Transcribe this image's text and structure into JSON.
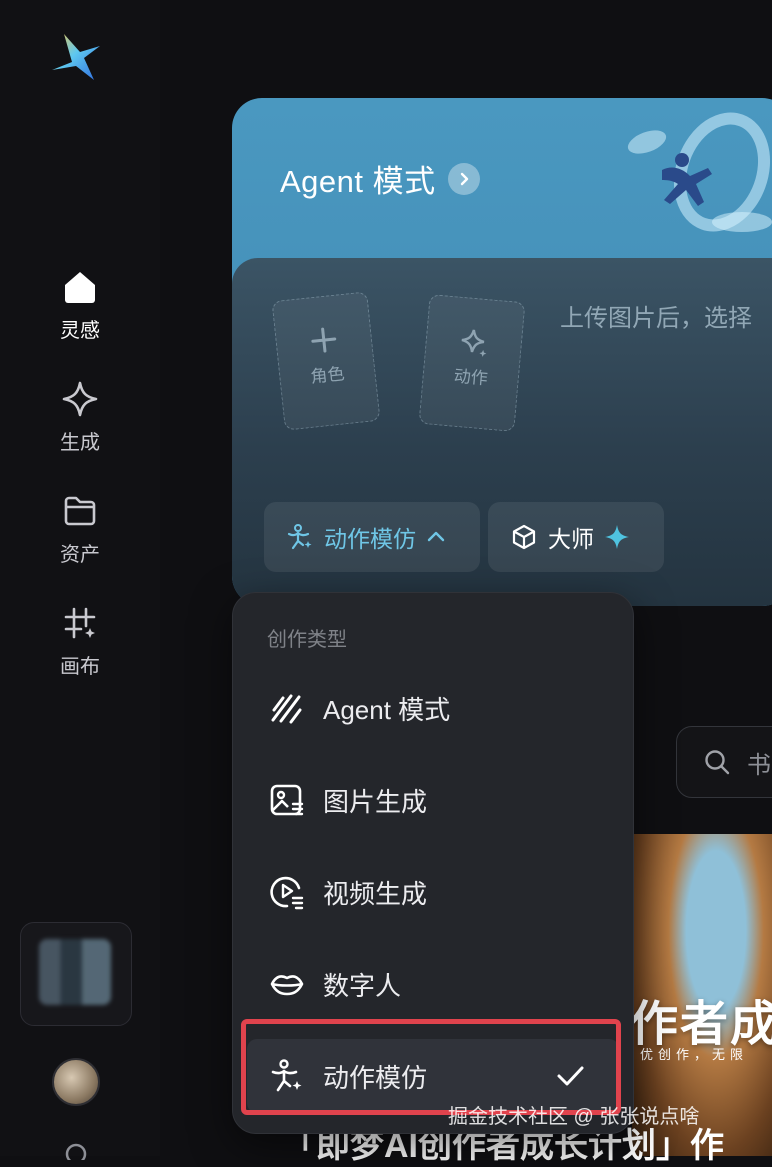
{
  "sidebar": {
    "items": [
      {
        "label": "灵感",
        "icon": "home-icon",
        "active": true
      },
      {
        "label": "生成",
        "icon": "sparkle-diamond-icon",
        "active": false
      },
      {
        "label": "资产",
        "icon": "folder-icon",
        "active": false
      },
      {
        "label": "画布",
        "icon": "canvas-grid-icon",
        "active": false
      }
    ]
  },
  "card": {
    "title": "Agent 模式",
    "upload_hint": "上传图片后，选择",
    "slots": [
      {
        "label": "角色",
        "icon": "plus-icon"
      },
      {
        "label": "动作",
        "icon": "sparkle-diamond-icon"
      }
    ],
    "chips": {
      "mode_label": "动作模仿",
      "model_label": "大师"
    }
  },
  "dropdown": {
    "heading": "创作类型",
    "items": [
      {
        "label": "Agent 模式",
        "icon": "agent-stripes-icon"
      },
      {
        "label": "图片生成",
        "icon": "image-gen-icon"
      },
      {
        "label": "视频生成",
        "icon": "video-gen-icon"
      },
      {
        "label": "数字人",
        "icon": "lips-icon"
      },
      {
        "label": "动作模仿",
        "icon": "motion-figure-icon",
        "selected": true
      }
    ]
  },
  "search": {
    "placeholder": "书"
  },
  "banner": {
    "headline": "作者成长",
    "subline": "优创作，无限",
    "bottom_title": "「即梦AI创作者成长计划」作"
  },
  "watermark": "掘金技术社区 @ 张张说点啥",
  "colors": {
    "accent": "#4fc3e0",
    "highlight_border": "#e0434d",
    "card_top": "#4a98c0"
  }
}
